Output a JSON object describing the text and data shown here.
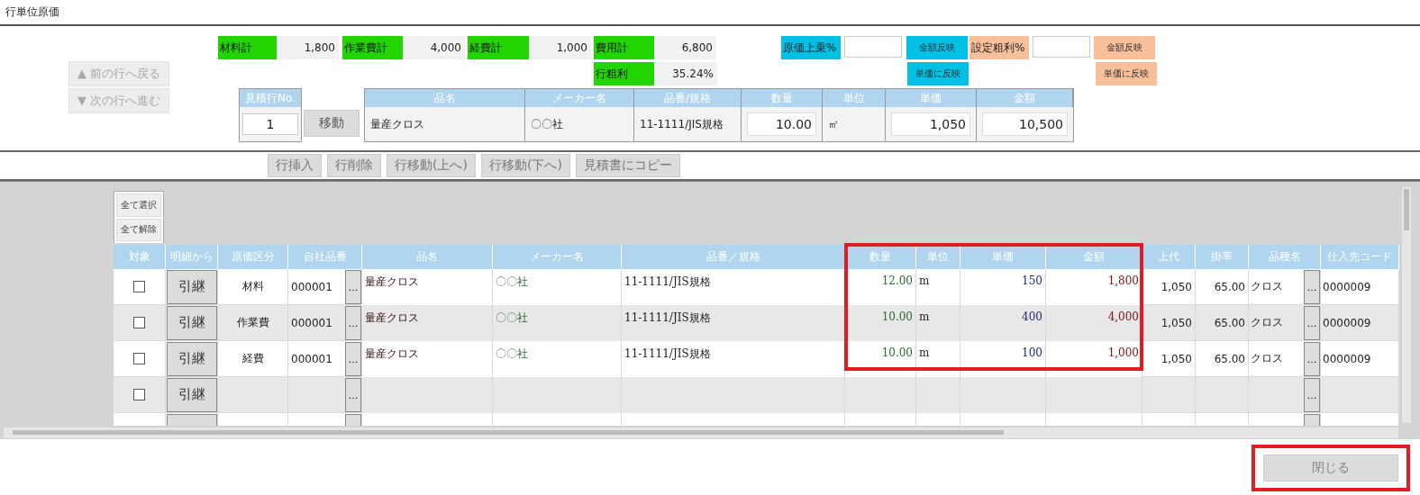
{
  "window": {
    "title": "行単位原価"
  },
  "nav_buttons": [
    {
      "label": "▲ 前の行へ戻る",
      "disabled": true
    },
    {
      "label": "▼ 次の行へ進む",
      "disabled": true
    }
  ],
  "totals": [
    {
      "label": "材料計",
      "value": "1,800"
    },
    {
      "label": "作業費計",
      "value": "4,000"
    },
    {
      "label": "経費計",
      "value": "1,000"
    },
    {
      "label": "費用計",
      "value": "6,800"
    }
  ],
  "gross_margin": {
    "label": "行粗利",
    "value": "35.24%"
  },
  "markup": {
    "label": "原価上乗%",
    "amount_button": "金額反映",
    "unit_button": "単価に反映"
  },
  "target_margin": {
    "label": "設定粗利%",
    "amount_button": "金額反映",
    "unit_button": "単価に反映"
  },
  "row_no": {
    "label": "見積行No.",
    "value": "1",
    "move_button": "移動"
  },
  "current_row": {
    "columns": [
      "品名",
      "メーカー名",
      "品番/規格",
      "数量",
      "単位",
      "単価",
      "金額"
    ],
    "name": "量産クロス",
    "maker": "〇〇社",
    "spec": "11-1111/JIS規格",
    "qty": "10.00",
    "unit": "㎡",
    "price": "1,050",
    "amount": "10,500"
  },
  "actions": [
    {
      "label": "行挿入",
      "disabled": true
    },
    {
      "label": "行削除",
      "disabled": true
    },
    {
      "label": "行移動(上へ)",
      "disabled": true
    },
    {
      "label": "行移動(下へ)",
      "disabled": true
    },
    {
      "label": "見積書にコピー",
      "disabled": true
    }
  ],
  "select_all": "全て選択",
  "deselect_all": "全て解除",
  "table": {
    "columns": [
      "対象",
      "明細から",
      "原価区分",
      "自社品番",
      "品名",
      "メーカー名",
      "品番／規格",
      "数量",
      "単位",
      "単価",
      "金額",
      "上代",
      "掛率",
      "品種名",
      "仕入先コード"
    ],
    "rows": [
      {
        "checked": false,
        "button": "引継",
        "category": "材料",
        "code": "000001",
        "code_button": "…",
        "name": "量産クロス",
        "maker": "〇〇社",
        "spec": "11-1111/JIS規格",
        "qty": "12.00",
        "unit": "m",
        "price": "150",
        "amount": "1,800",
        "list_price": "1,050",
        "rate": "65.00",
        "kind_button": "…",
        "kind_name": "クロス",
        "supplier": "0000009"
      },
      {
        "checked": false,
        "button": "引継",
        "category": "作業費",
        "code": "000001",
        "code_button": "…",
        "name": "量産クロス",
        "maker": "〇〇社",
        "spec": "11-1111/JIS規格",
        "qty": "10.00",
        "unit": "m",
        "price": "400",
        "amount": "4,000",
        "list_price": "1,050",
        "rate": "65.00",
        "kind_button": "…",
        "kind_name": "クロス",
        "supplier": "0000009"
      },
      {
        "checked": false,
        "button": "引継",
        "category": "経費",
        "code": "000001",
        "code_button": "…",
        "name": "量産クロス",
        "maker": "〇〇社",
        "spec": "11-1111/JIS規格",
        "qty": "10.00",
        "unit": "m",
        "price": "100",
        "amount": "1,000",
        "list_price": "1,050",
        "rate": "65.00",
        "kind_button": "…",
        "kind_name": "クロス",
        "supplier": "0000009"
      },
      {
        "checked": false,
        "button": "引継",
        "code_button": "…",
        "kind_button": "…"
      }
    ],
    "cut_off_row": true
  },
  "close_button": {
    "label": "閉じる",
    "disabled": true
  }
}
